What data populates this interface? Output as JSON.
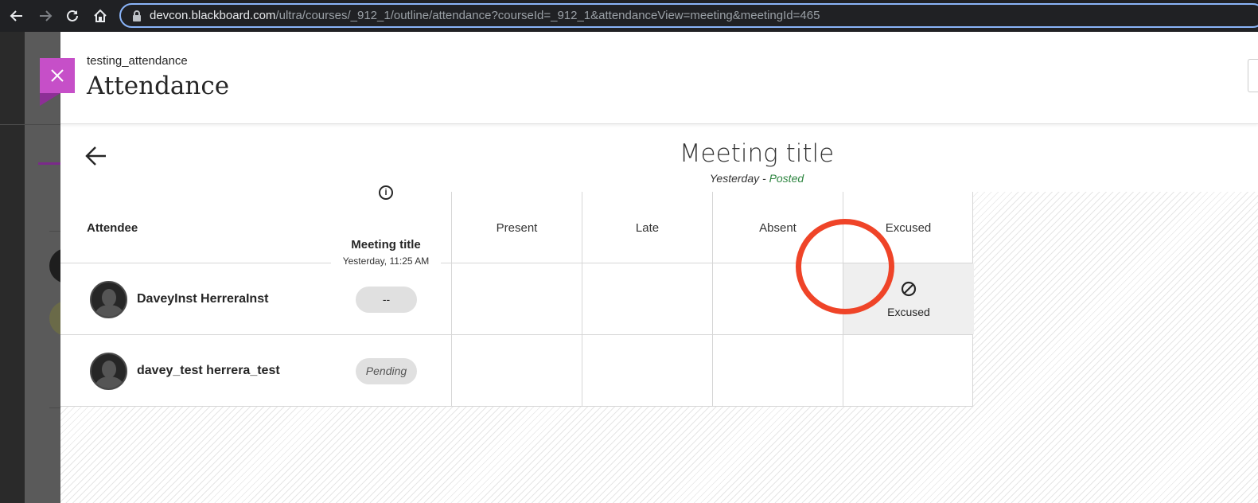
{
  "browser": {
    "url_host": "devcon.blackboard.com",
    "url_path": "/ultra/courses/_912_1/outline/attendance?courseId=_912_1&attendanceView=meeting&meetingId=465"
  },
  "panel": {
    "course_name": "testing_attendance",
    "title": "Attendance"
  },
  "meeting": {
    "title": "Meeting title",
    "date": "Yesterday",
    "separator": " - ",
    "status": "Posted"
  },
  "table": {
    "attendee_header": "Attendee",
    "meeting_column": {
      "title": "Meeting title",
      "date": "Yesterday, 11:25 AM"
    },
    "columns": [
      "Present",
      "Late",
      "Absent",
      "Excused"
    ],
    "rows": [
      {
        "name": "DaveyInst HerreraInst",
        "status": "--",
        "selected": "Excused"
      },
      {
        "name": "davey_test herrera_test",
        "status": "Pending",
        "selected": ""
      }
    ]
  },
  "colors": {
    "accent": "#c64fc8",
    "posted": "#2e8540",
    "highlight": "#ef4428"
  }
}
